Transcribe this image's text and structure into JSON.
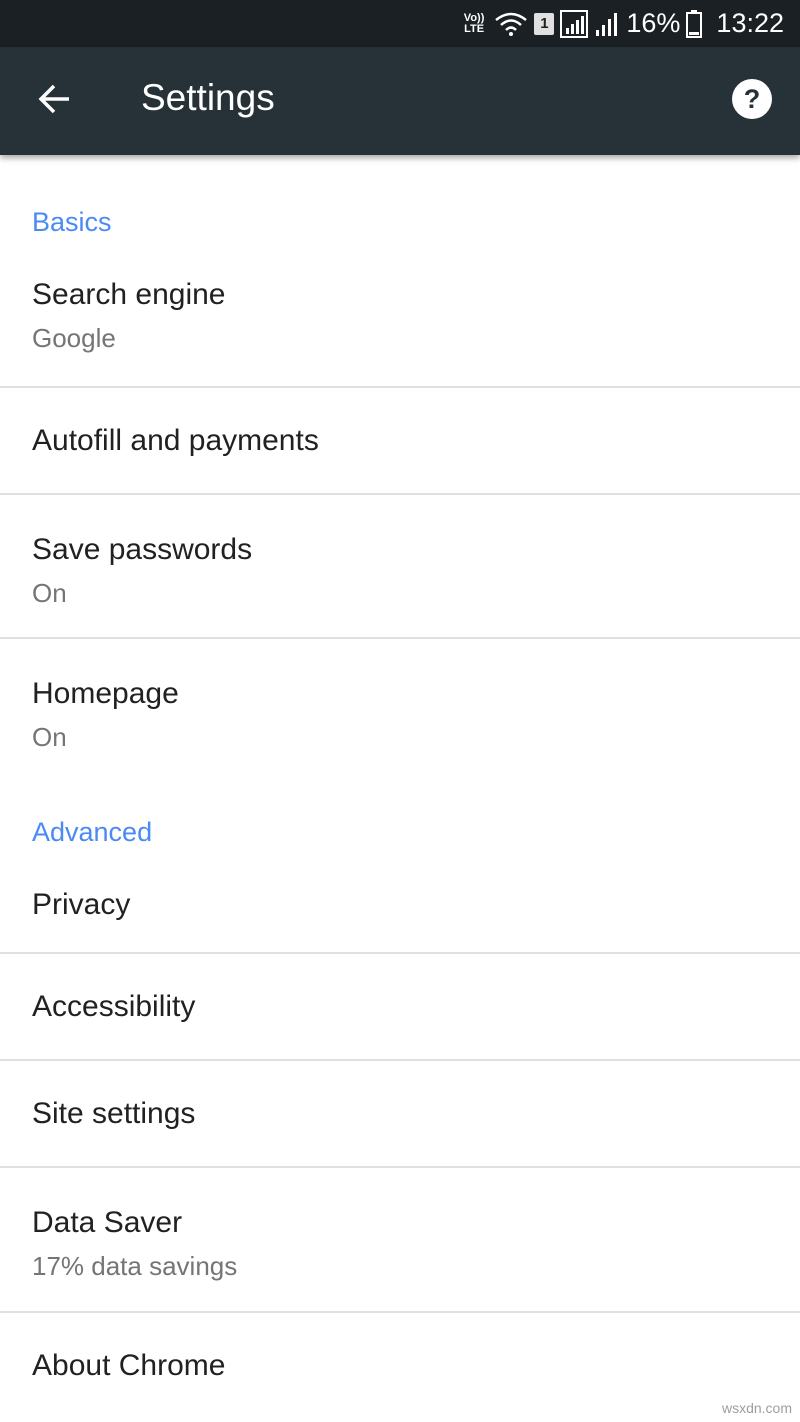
{
  "status_bar": {
    "volte_top": "Vo))",
    "volte_bottom": "LTE",
    "sim_slot": "1",
    "battery_percent": "16%",
    "time": "13:22"
  },
  "app_bar": {
    "title": "Settings",
    "back_icon": "arrow-back-icon",
    "help_icon": "help-circle-icon"
  },
  "sections": {
    "basics": {
      "header": "Basics",
      "items": [
        {
          "title": "Search engine",
          "summary": "Google"
        },
        {
          "title": "Autofill and payments"
        },
        {
          "title": "Save passwords",
          "summary": "On"
        },
        {
          "title": "Homepage",
          "summary": "On"
        }
      ]
    },
    "advanced": {
      "header": "Advanced",
      "items": [
        {
          "title": "Privacy"
        },
        {
          "title": "Accessibility"
        },
        {
          "title": "Site settings"
        },
        {
          "title": "Data Saver",
          "summary": "17% data savings"
        },
        {
          "title": "About Chrome"
        }
      ]
    }
  },
  "watermark": "wsxdn.com",
  "colors": {
    "status_bar_bg": "#1b2024",
    "app_bar_bg": "#263238",
    "section_header": "#4a8af4",
    "divider": "#e0e0e0"
  }
}
